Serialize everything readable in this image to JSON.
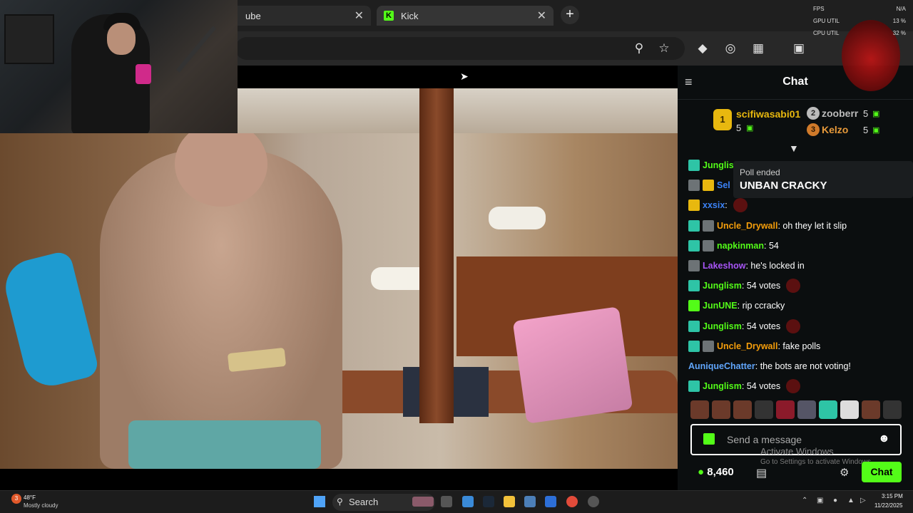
{
  "browser": {
    "tabs": [
      {
        "label": "ube"
      },
      {
        "label": "Kick"
      }
    ],
    "new_tab": "+",
    "close": "✕"
  },
  "overlay": {
    "perf": [
      {
        "label": "FPS",
        "value": "N/A"
      },
      {
        "label": "GPU UTIL",
        "value": "13 %"
      },
      {
        "label": "CPU UTIL",
        "value": "32 %"
      }
    ]
  },
  "chat": {
    "title": "Chat",
    "leaderboard": {
      "first": {
        "rank": "1",
        "name": "scifiwasabi01",
        "count": "5"
      },
      "second": {
        "rank": "2",
        "name": "zooberr",
        "count": "5"
      },
      "third": {
        "rank": "3",
        "name": "Kelzo",
        "count": "5"
      }
    },
    "poll": {
      "label": "Poll ended",
      "title": "UNBAN CRACKY"
    },
    "messages": [
      {
        "user": "Junglis",
        "color": "#53fc18",
        "text": "",
        "badges": [
          "green"
        ],
        "emote": false
      },
      {
        "user": "Sel",
        "color": "#3b82f6",
        "text": "",
        "badges": [
          "gray",
          "gold"
        ],
        "emote": false
      },
      {
        "user": "xxsix",
        "color": "#3b82f6",
        "text": ":",
        "badges": [
          "gold"
        ],
        "emote": true
      },
      {
        "user": "Uncle_Drywall",
        "color": "#f59e0b",
        "text": ": oh they let it slip",
        "badges": [
          "green",
          "gray"
        ],
        "emote": false
      },
      {
        "user": "napkinman",
        "color": "#53fc18",
        "text": ": 54",
        "badges": [
          "green",
          "gray"
        ],
        "emote": false
      },
      {
        "user": "Lakeshow",
        "color": "#a855f7",
        "text": ": he's locked in",
        "badges": [
          "gray"
        ],
        "emote": false
      },
      {
        "user": "Junglism",
        "color": "#53fc18",
        "text": ": 54 votes",
        "badges": [
          "green"
        ],
        "emote": true
      },
      {
        "user": "JunUNE",
        "color": "#53fc18",
        "text": ": rip ccracky",
        "badges": [
          "lime"
        ],
        "emote": false
      },
      {
        "user": "Junglism",
        "color": "#53fc18",
        "text": ": 54 votes",
        "badges": [
          "green"
        ],
        "emote": true
      },
      {
        "user": "Uncle_Drywall",
        "color": "#f59e0b",
        "text": ": fake polls",
        "badges": [
          "green",
          "gray"
        ],
        "emote": false
      },
      {
        "user": "AuniqueChatter",
        "color": "#60a5fa",
        "text": ": the bots are not voting!",
        "badges": [],
        "emote": false
      },
      {
        "user": "Junglism",
        "color": "#53fc18",
        "text": ": 54 votes",
        "badges": [
          "green"
        ],
        "emote": true
      }
    ],
    "input_placeholder": "Send a message",
    "points": "8,460",
    "chat_button": "Chat",
    "watermark_line1": "Activate Windows",
    "watermark_line2": "Go to Settings to activate Windows."
  },
  "taskbar": {
    "weather_temp": "48°F",
    "weather_desc": "Mostly cloudy",
    "weather_badge": "3",
    "search_label": "Search",
    "time": "3:15 PM",
    "date": "11/22/2025"
  },
  "colors": {
    "kick_green": "#53fc18",
    "chat_bg": "#0b0e0f"
  }
}
